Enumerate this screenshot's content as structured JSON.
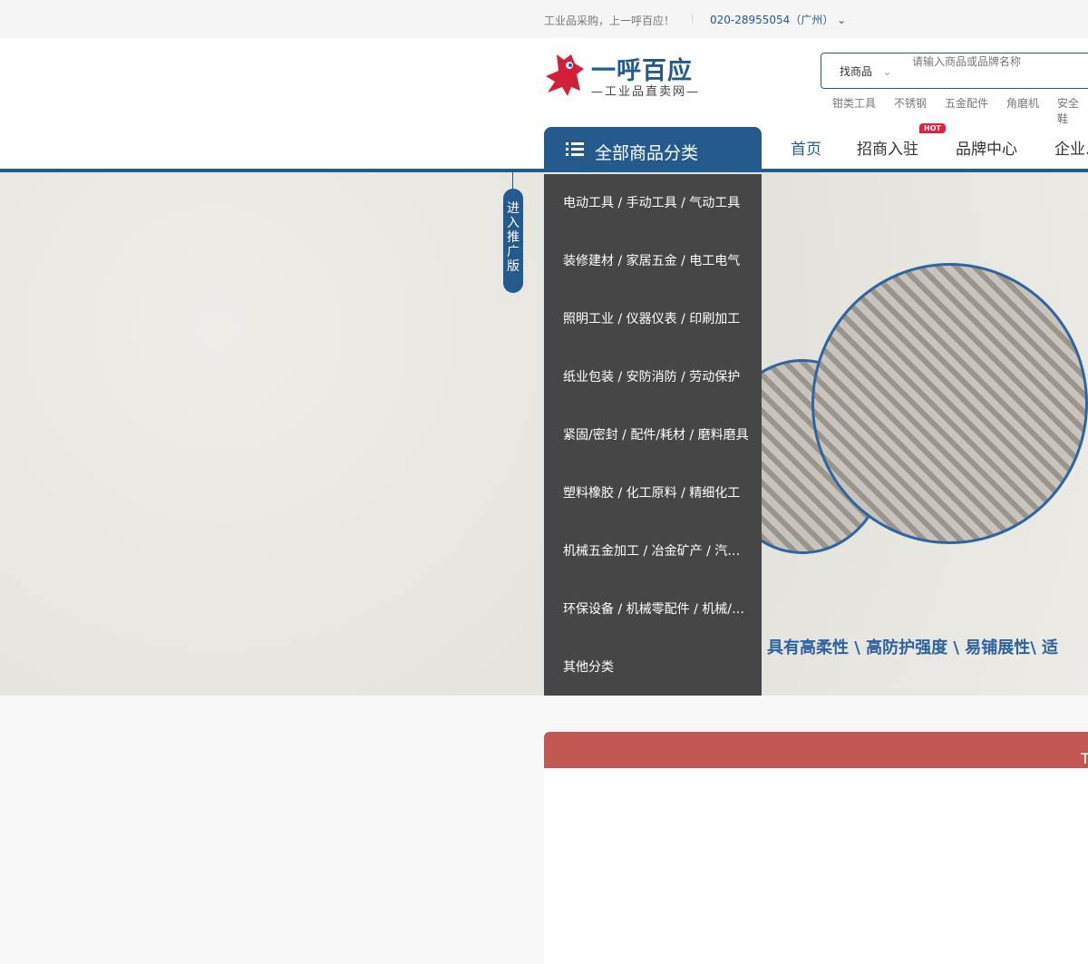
{
  "topbar": {
    "slogan": "工业品采购，上一呼百应！",
    "separator": "|",
    "phone": "020-28955054（广州）"
  },
  "logo": {
    "name": "一呼百应",
    "tagline": "—工业品直卖网—"
  },
  "search": {
    "type": "找商品",
    "placeholder": "请输入商品或品牌名称",
    "hot_keywords": [
      "钳类工具",
      "不锈钢",
      "五金配件",
      "角磨机",
      "安全鞋"
    ]
  },
  "category_button": "全部商品分类",
  "nav": [
    {
      "label": "首页"
    },
    {
      "label": "招商入驻",
      "badge": "HOT"
    },
    {
      "label": "品牌中心"
    },
    {
      "label": "企业..."
    }
  ],
  "categories": [
    "电动工具 / 手动工具 / 气动工具",
    "装修建材 / 家居五金 / 电工电气",
    "照明工业 / 仪器仪表 / 印刷加工",
    "纸业包装 / 安防消防 / 劳动保护",
    "紧固/密封 / 配件/耗材 / 磨料磨具",
    "塑料橡胶 / 化工原料 / 精细化工",
    "机械五金加工 / 冶金矿产 / 汽车用品",
    "环保设备 / 机械零配件 / 机械/设备",
    "其他分类"
  ],
  "promo": "进入推广版",
  "banner_text": "具有高柔性 \\ 高防护强度 \\ 易铺展性\\ 适",
  "panel_title": "T"
}
